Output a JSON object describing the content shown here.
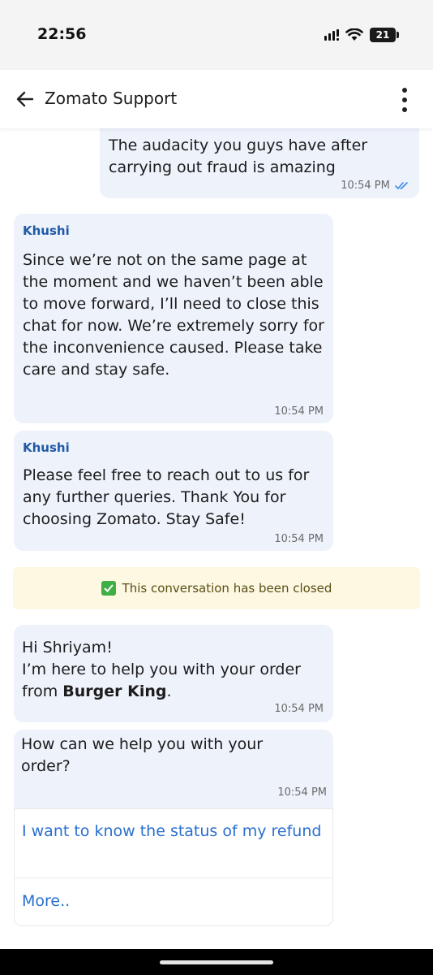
{
  "status_bar": {
    "time": "22:56",
    "battery": "21"
  },
  "header": {
    "title": "Zomato Support"
  },
  "messages": [
    {
      "text": "The audacity you guys have after carrying out fraud is amazing",
      "time": "10:54 PM"
    },
    {
      "sender": "Khushi",
      "text": "Since we’re not on the same page at the moment and we haven’t been able to move forward, I’ll need to close this chat for now. We’re extremely sorry for the inconvenience caused. Please take care and stay safe.",
      "time": "10:54 PM"
    },
    {
      "sender": "Khushi",
      "text": "Please feel free to reach out to us for any further queries. Thank You for choosing Zomato. Stay Safe!",
      "time": "10:54 PM"
    },
    {
      "text_line1": "Hi Shriyam!",
      "text_line2": "I’m here to help you with your order from ",
      "brand": "Burger King",
      "brand_suffix": ".",
      "time": "10:54 PM"
    },
    {
      "text": "How can we help you with your order?",
      "time": "10:54 PM"
    }
  ],
  "closed_banner": {
    "emoji": "✅",
    "text": "This conversation has been closed"
  },
  "options": [
    {
      "label": "I want to know the status of my refund"
    },
    {
      "label": "More.."
    }
  ],
  "colors": {
    "bubble_bg": "#eef2fb",
    "accent": "#2a6fcf",
    "sender": "#1f5aa6",
    "banner_bg": "#fdf8e2"
  }
}
